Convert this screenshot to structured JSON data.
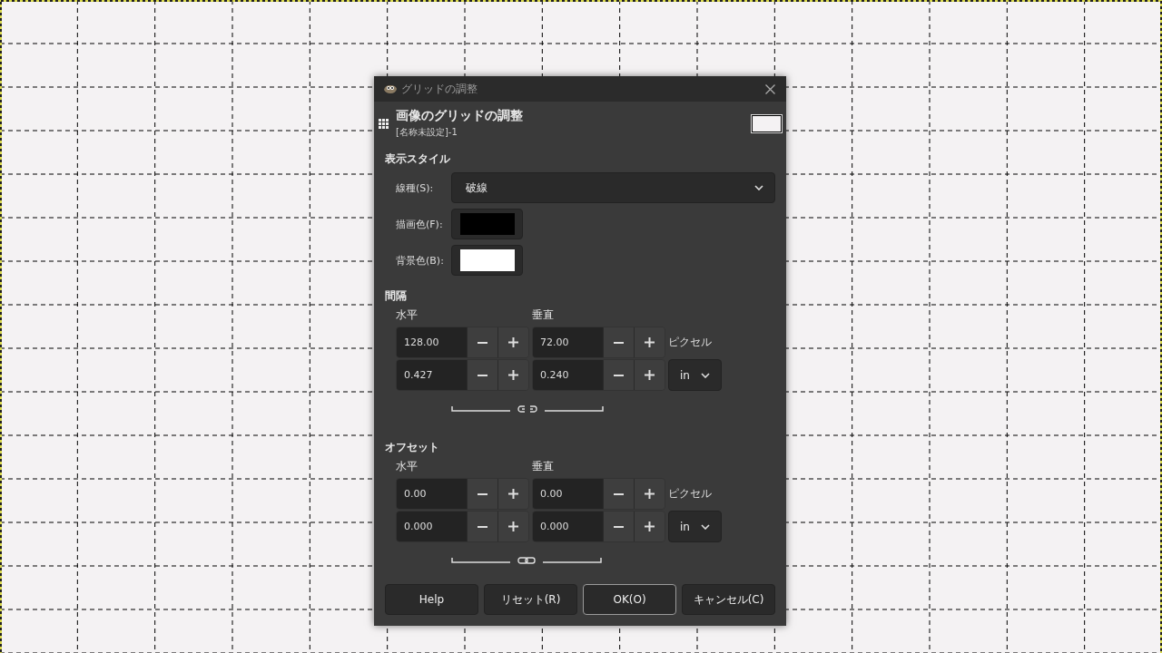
{
  "window": {
    "title": "グリッドの調整"
  },
  "header": {
    "title": "画像のグリッドの調整",
    "subtitle": "[名称未設定]-1"
  },
  "appearance": {
    "heading": "表示スタイル",
    "line_style": {
      "label": "線種(S):",
      "value": "破線"
    },
    "colors": [
      {
        "label": "描画色(F):",
        "color": "#000000"
      },
      {
        "label": "背景色(B):",
        "color": "#ffffff"
      }
    ]
  },
  "sections": [
    {
      "heading": "間隔",
      "columns": [
        "水平",
        "垂直"
      ],
      "pixel_values": [
        "128.00",
        "72.00"
      ],
      "pixel_unit": "ピクセル",
      "unit_values": [
        "0.427",
        "0.240"
      ],
      "unit": "in",
      "chained": false
    },
    {
      "heading": "オフセット",
      "columns": [
        "水平",
        "垂直"
      ],
      "pixel_values": [
        "0.00",
        "0.00"
      ],
      "pixel_unit": "ピクセル",
      "unit_values": [
        "0.000",
        "0.000"
      ],
      "unit": "in",
      "chained": true
    }
  ],
  "buttons": [
    {
      "label": "Help",
      "default": false
    },
    {
      "label": "リセット(R)",
      "default": false
    },
    {
      "label": "OK(O)",
      "default": true
    },
    {
      "label": "キャンセル(C)",
      "default": false
    }
  ]
}
